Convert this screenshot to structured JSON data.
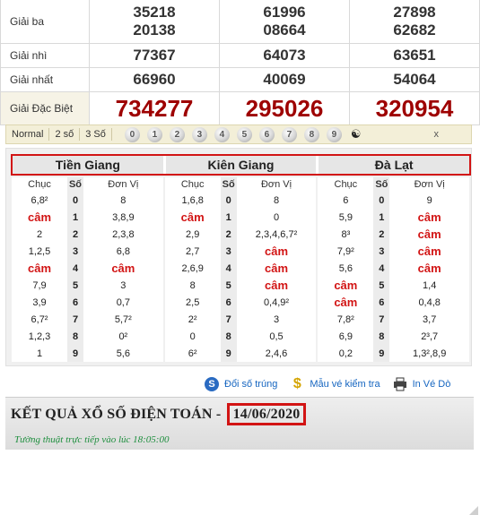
{
  "prizes": {
    "ba": {
      "label": "Giải ba",
      "cols": [
        [
          "35218",
          "20138"
        ],
        [
          "61996",
          "08664"
        ],
        [
          "27898",
          "62682"
        ]
      ]
    },
    "nhi": {
      "label": "Giải nhì",
      "cols": [
        "77367",
        "64073",
        "63651"
      ]
    },
    "nhat": {
      "label": "Giải nhất",
      "cols": [
        "66960",
        "40069",
        "54064"
      ]
    },
    "dac_biet": {
      "label": "Giải Đặc Biệt",
      "cols": [
        "734277",
        "295026",
        "320954"
      ]
    }
  },
  "filter": {
    "options": [
      "Normal",
      "2 số",
      "3 Số"
    ],
    "digits": [
      "0",
      "1",
      "2",
      "3",
      "4",
      "5",
      "6",
      "7",
      "8",
      "9"
    ],
    "yin_yang": "☯",
    "close": "x"
  },
  "loto": {
    "provinces": [
      "Tiền Giang",
      "Kiên Giang",
      "Đà Lạt"
    ],
    "headers": {
      "chuc": "Chục",
      "so": "Số",
      "don_vi": "Đơn Vị"
    },
    "tables": [
      {
        "rows": [
          {
            "chuc": "6,8²",
            "so": "0",
            "dv": "8"
          },
          {
            "chuc": "câm",
            "so": "1",
            "dv": "3,8,9"
          },
          {
            "chuc": "2",
            "so": "2",
            "dv": "2,3,8"
          },
          {
            "chuc": "1,2,5",
            "so": "3",
            "dv": "6,8"
          },
          {
            "chuc": "câm",
            "so": "4",
            "dv": "câm"
          },
          {
            "chuc": "7,9",
            "so": "5",
            "dv": "3"
          },
          {
            "chuc": "3,9",
            "so": "6",
            "dv": "0,7"
          },
          {
            "chuc": "6,7²",
            "so": "7",
            "dv": "5,7²"
          },
          {
            "chuc": "1,2,3",
            "so": "8",
            "dv": "0²"
          },
          {
            "chuc": "1",
            "so": "9",
            "dv": "5,6"
          }
        ]
      },
      {
        "rows": [
          {
            "chuc": "1,6,8",
            "so": "0",
            "dv": "8"
          },
          {
            "chuc": "câm",
            "so": "1",
            "dv": "0"
          },
          {
            "chuc": "2,9",
            "so": "2",
            "dv": "2,3,4,6,7²"
          },
          {
            "chuc": "2,7",
            "so": "3",
            "dv": "câm"
          },
          {
            "chuc": "2,6,9",
            "so": "4",
            "dv": "câm"
          },
          {
            "chuc": "8",
            "so": "5",
            "dv": "câm"
          },
          {
            "chuc": "2,5",
            "so": "6",
            "dv": "0,4,9²"
          },
          {
            "chuc": "2²",
            "so": "7",
            "dv": "3"
          },
          {
            "chuc": "0",
            "so": "8",
            "dv": "0,5"
          },
          {
            "chuc": "6²",
            "so": "9",
            "dv": "2,4,6"
          }
        ]
      },
      {
        "rows": [
          {
            "chuc": "6",
            "so": "0",
            "dv": "9"
          },
          {
            "chuc": "5,9",
            "so": "1",
            "dv": "câm"
          },
          {
            "chuc": "8³",
            "so": "2",
            "dv": "câm"
          },
          {
            "chuc": "7,9²",
            "so": "3",
            "dv": "câm"
          },
          {
            "chuc": "5,6",
            "so": "4",
            "dv": "câm"
          },
          {
            "chuc": "câm",
            "so": "5",
            "dv": "1,4"
          },
          {
            "chuc": "câm",
            "so": "6",
            "dv": "0,4,8"
          },
          {
            "chuc": "7,8²",
            "so": "7",
            "dv": "3,7"
          },
          {
            "chuc": "6,9",
            "so": "8",
            "dv": "2³,7"
          },
          {
            "chuc": "0,2",
            "so": "9",
            "dv": "1,3²,8,9"
          }
        ]
      }
    ]
  },
  "actions": [
    {
      "label": "Đổi số trúng",
      "icon": "refresh-icon"
    },
    {
      "label": "Mẫu vé kiểm tra",
      "icon": "dollar-icon"
    },
    {
      "label": "In Vé Dò",
      "icon": "printer-icon"
    }
  ],
  "result": {
    "title": "KẾT QUẢ XỔ SỐ ĐIỆN TOÁN - ",
    "date": "14/06/2020",
    "subtitle": "Tường thuật trực tiếp vào lúc 18:05:00"
  },
  "colors": {
    "accent_red": "#d21414",
    "special_prize": "#9e0000",
    "link_blue": "#1565c0",
    "live_green": "#1e8e3e"
  }
}
